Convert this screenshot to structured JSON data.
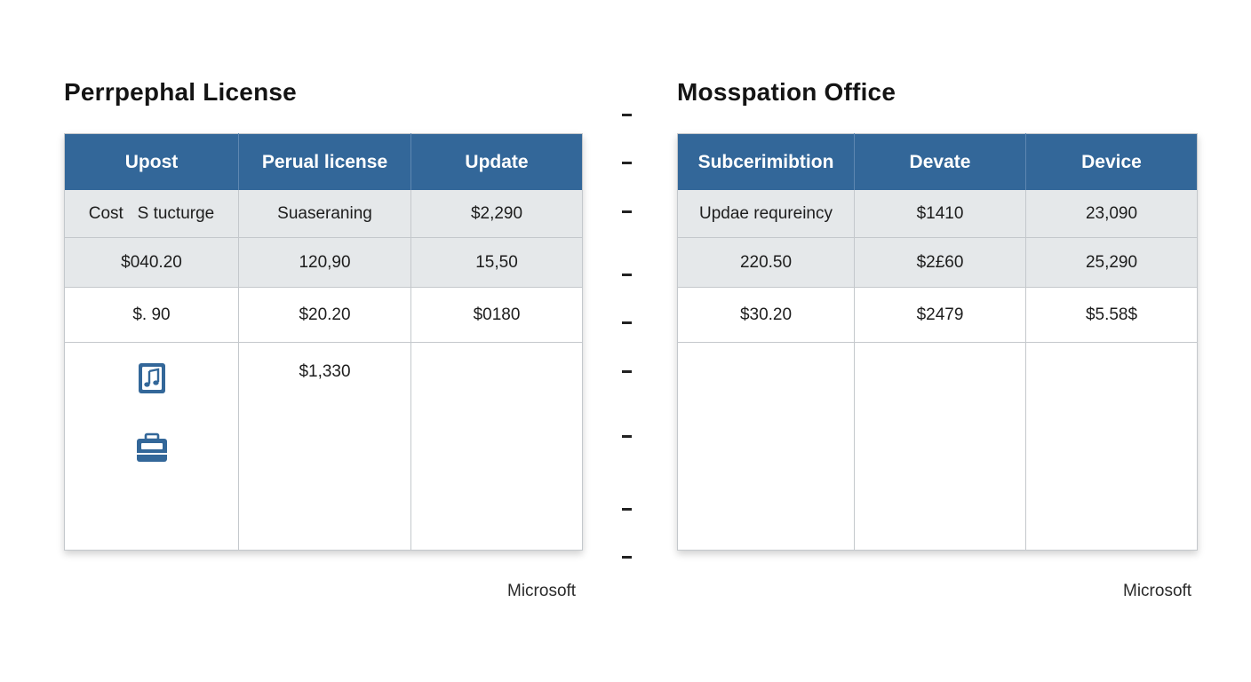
{
  "left_panel": {
    "title": "Perrpephal License",
    "columns": [
      "Upost",
      "Perual license",
      "Update"
    ],
    "rows": [
      [
        "Cost   S tucturge",
        "Suaseraning",
        "$2,290"
      ],
      [
        "$040.20",
        "120,90",
        "15,50"
      ],
      [
        "$. 90",
        "$20.20",
        "$0180"
      ],
      [
        "",
        "$1,330",
        ""
      ]
    ],
    "row_icons": [
      "music-file-icon",
      "briefcase-icon"
    ],
    "footer": "Microsoft"
  },
  "right_panel": {
    "title": "Mosspation Office",
    "columns": [
      "Subcerimibtion",
      "Devate",
      "Device"
    ],
    "rows": [
      [
        "Updae requreincy",
        "$1410",
        "23,090"
      ],
      [
        "220.50",
        "$2£60",
        "25,290"
      ],
      [
        "$30.20",
        "$2479",
        "$5.58$"
      ],
      [
        "",
        "",
        ""
      ]
    ],
    "footer": "Microsoft"
  },
  "colors": {
    "header_bg": "#336799",
    "shaded_row": "#e5e8ea",
    "grid": "#c4c8cc"
  }
}
